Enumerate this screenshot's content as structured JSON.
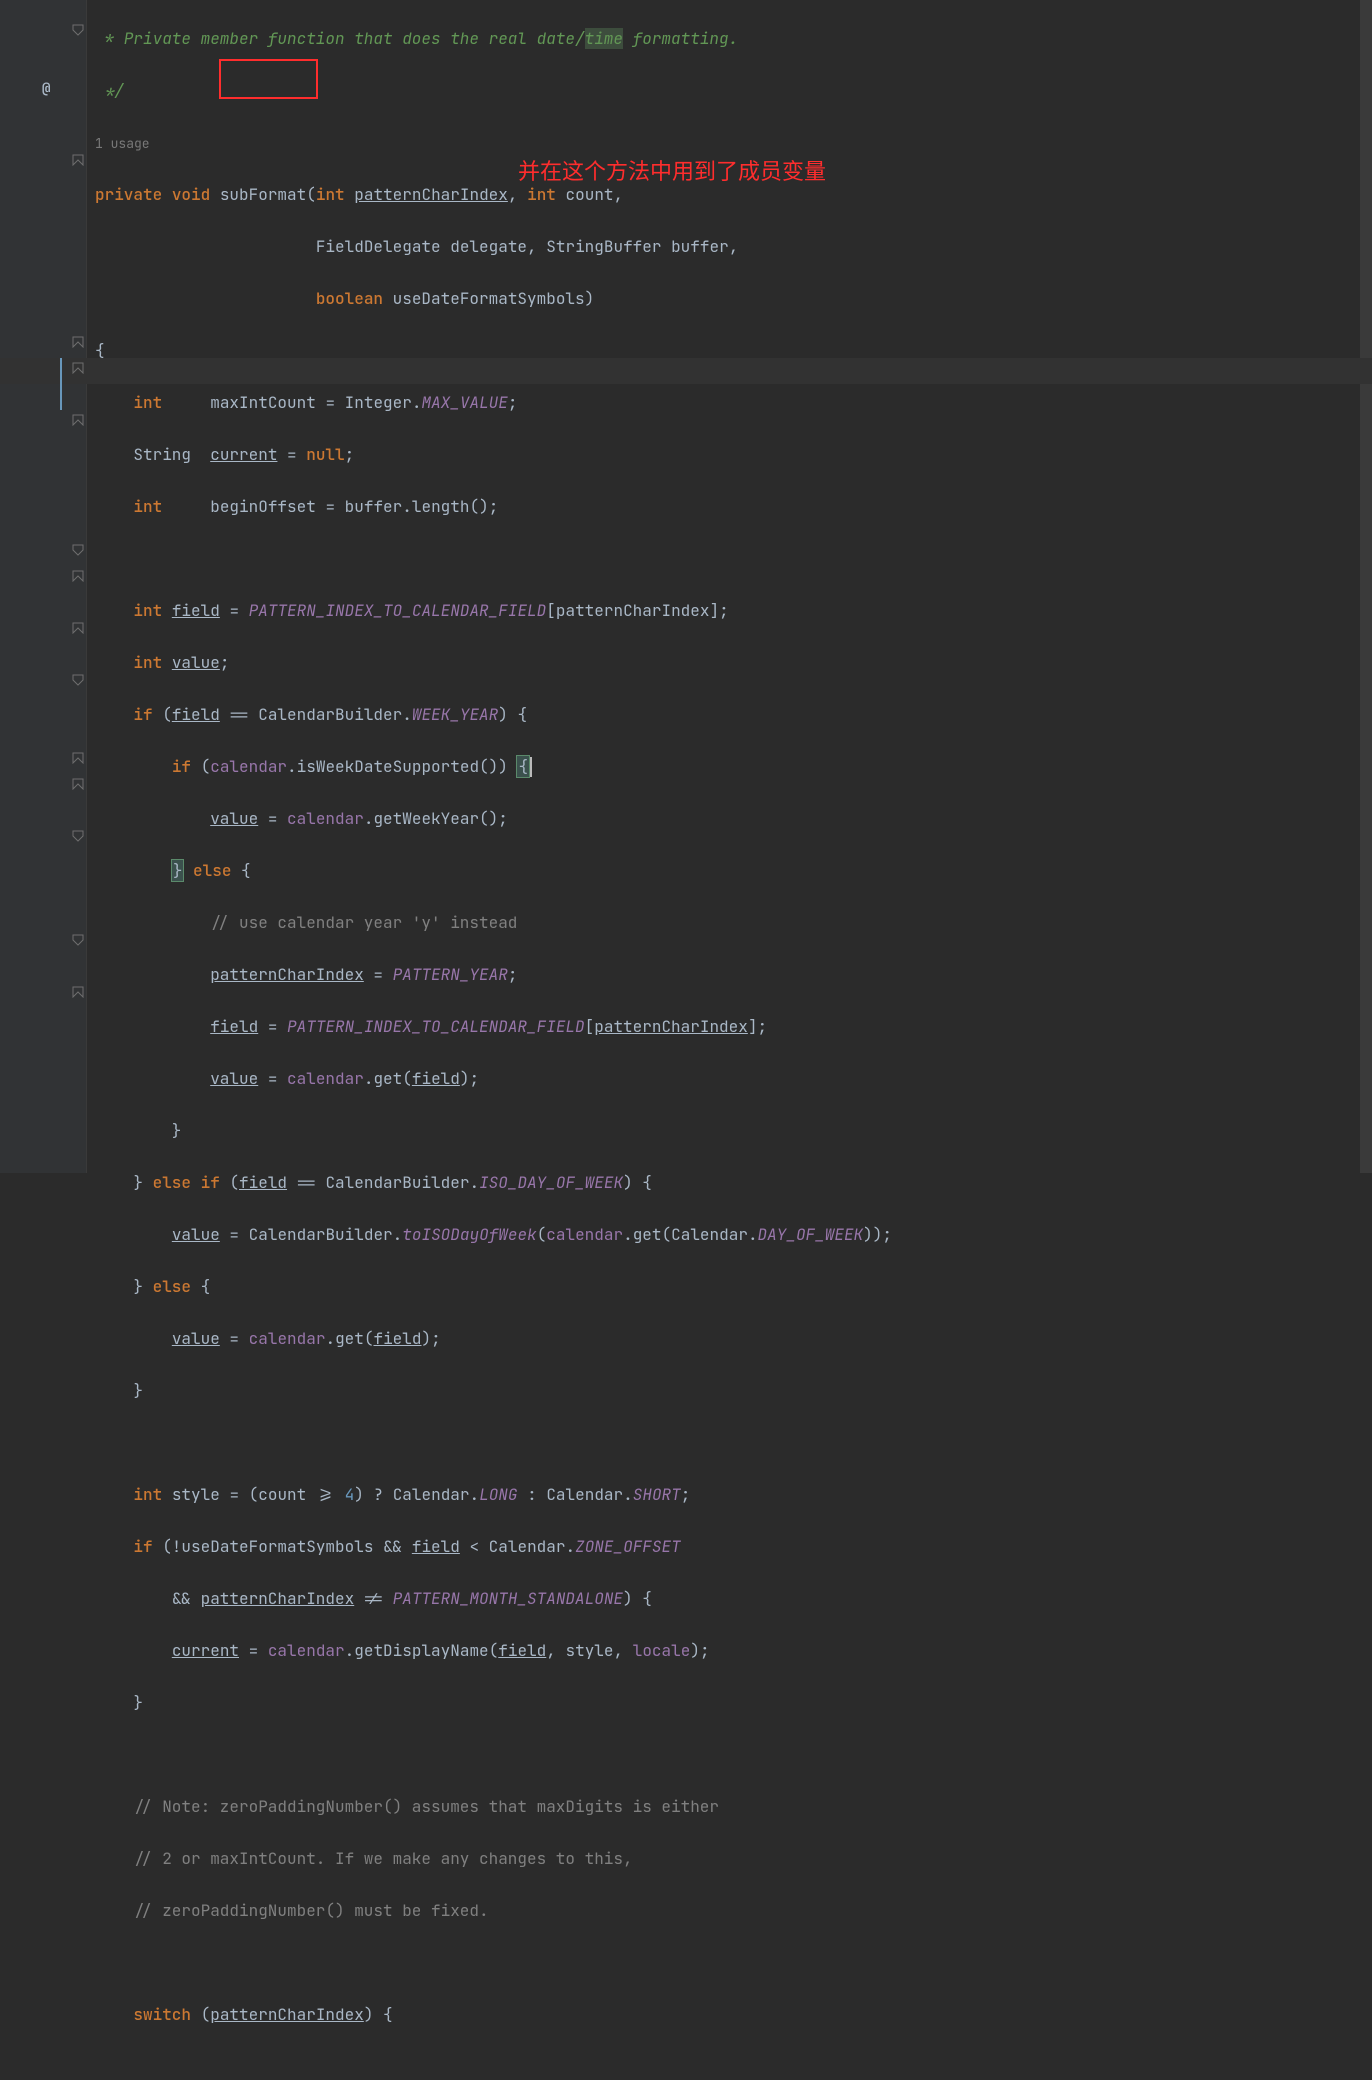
{
  "annotation": {
    "box_method": "subFormat",
    "red_text": "并在这个方法中用到了成员变量"
  },
  "override_glyph": "@",
  "usage_hint": "1 usage",
  "comment": {
    "l1": " * Private member function that does the real date/",
    "l1_hl": "time",
    "l1_tail": " formatting.",
    "l2": " */"
  },
  "sig": {
    "mod_private": "private",
    "mod_void": "void",
    "name": "subFormat",
    "p1_type": "int",
    "p1_name": "patternCharIndex",
    "p2_type": "int",
    "p2_name": "count",
    "p3_type": "FieldDelegate",
    "p3_name": "delegate",
    "p4_type": "StringBuffer",
    "p4_name": "buffer",
    "p5_type": "boolean",
    "p5_name": "useDateFormatSymbols"
  },
  "body": {
    "int": "int",
    "String": "String",
    "null": "null",
    "if": "if",
    "else": "else",
    "else_if": "else if",
    "switch": "switch",
    "maxIntCount": "maxIntCount",
    "Integer": "Integer",
    "MAX_VALUE": "MAX_VALUE",
    "current": "current",
    "beginOffset": "beginOffset",
    "buffer": "buffer",
    "length": "length()",
    "field": "field",
    "PATTERN_INDEX_TO_CALENDAR_FIELD": "PATTERN_INDEX_TO_CALENDAR_FIELD",
    "patternCharIndex": "patternCharIndex",
    "value": "value",
    "CalendarBuilder": "CalendarBuilder",
    "WEEK_YEAR": "WEEK_YEAR",
    "calendar": "calendar",
    "isWeekDateSupported": "isWeekDateSupported()",
    "getWeekYear": "getWeekYear()",
    "use_cal_y_comment": "// use calendar year 'y' instead",
    "PATTERN_YEAR": "PATTERN_YEAR",
    "get": "get",
    "ISO_DAY_OF_WEEK": "ISO_DAY_OF_WEEK",
    "toISODayOfWeek": "toISODayOfWeek",
    "Calendar": "Calendar",
    "DAY_OF_WEEK": "DAY_OF_WEEK",
    "style": "style",
    "count": "count",
    "four": "4",
    "LONG": "LONG",
    "SHORT": "SHORT",
    "useDateFormatSymbols": "useDateFormatSymbols",
    "ZONE_OFFSET": "ZONE_OFFSET",
    "PATTERN_MONTH_STANDALONE": "PATTERN_MONTH_STANDALONE",
    "getDisplayName": "getDisplayName",
    "locale": "locale",
    "note1": "// Note: zeroPaddingNumber() assumes that maxDigits is either",
    "note2": "// 2 or maxIntCount. If we make any changes to this,",
    "note3": "// zeroPaddingNumber() must be fixed."
  }
}
